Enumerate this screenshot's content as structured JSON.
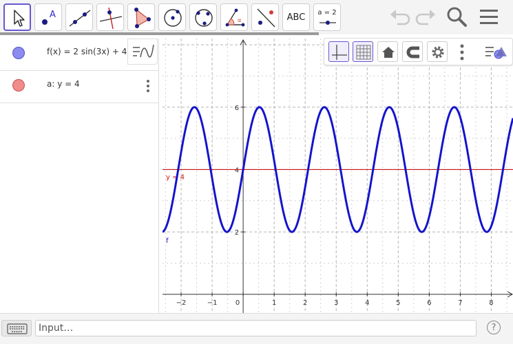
{
  "toolbar": {
    "tools": [
      {
        "name": "move-tool",
        "icon": "arrow-cursor-icon",
        "selected": true
      },
      {
        "name": "point-tool",
        "icon": "point-a-icon"
      },
      {
        "name": "line-tool",
        "icon": "line-through-points-icon"
      },
      {
        "name": "perpendicular-line-tool",
        "icon": "perpendicular-line-icon"
      },
      {
        "name": "polygon-tool",
        "icon": "polygon-icon"
      },
      {
        "name": "circle-center-point-tool",
        "icon": "circle-center-icon"
      },
      {
        "name": "circle-three-points-tool",
        "icon": "circle-three-points-icon"
      },
      {
        "name": "angle-tool",
        "icon": "angle-icon"
      },
      {
        "name": "reflect-tool",
        "icon": "reflect-about-line-icon"
      },
      {
        "name": "text-tool",
        "icon": "text-icon",
        "label": "ABC"
      },
      {
        "name": "slider-tool",
        "icon": "slider-icon",
        "label": "a = 2"
      }
    ],
    "undo_icon": "undo-icon",
    "redo_icon": "redo-icon",
    "search_icon": "search-icon",
    "menu_icon": "hamburger-menu-icon"
  },
  "algebra": {
    "items": [
      {
        "label": "f(x) = 2 sin(3x) + 4",
        "color": "#1414cc",
        "fill": "#8c8cf0"
      },
      {
        "label": "a: y = 4",
        "color": "#cc1414",
        "fill": "#f08c8c"
      }
    ],
    "toggle_icon": "algebra-style-icon"
  },
  "graphics": {
    "style_bar": {
      "buttons": [
        "axes-toggle-icon",
        "grid-toggle-icon",
        "home-icon",
        "magnet-icon",
        "settings-gear-icon",
        "more-vertical-icon",
        "graphics-style-icon"
      ]
    },
    "axis_color": "#333333",
    "grid_color": "#b4b4b4",
    "function_color": "#1414cc",
    "line_color": "#cc1414"
  },
  "chart_data": {
    "type": "line",
    "title": "",
    "xlabel": "",
    "ylabel": "",
    "xlim": [
      -2.6,
      8.7
    ],
    "ylim": [
      -0.6,
      8.2
    ],
    "x_ticks": [
      -2,
      -1,
      0,
      1,
      2,
      3,
      4,
      5,
      6,
      7,
      8
    ],
    "y_ticks": [
      2,
      4,
      6
    ],
    "x_tick_labels": [
      "−2",
      "−1",
      "0",
      "1",
      "2",
      "3",
      "4",
      "5",
      "6",
      "7",
      "8"
    ],
    "y_tick_labels": [
      "2",
      "4",
      "6"
    ],
    "grid": true,
    "series": [
      {
        "name": "f",
        "function": "2*sin(3*x)+4",
        "color": "#1414cc",
        "label": "f"
      },
      {
        "name": "a",
        "function": "4",
        "color": "#cc1414",
        "label": "y = 4"
      }
    ]
  },
  "input_bar": {
    "placeholder": "Input…",
    "keyboard_icon": "keyboard-icon",
    "help_label": "?"
  }
}
